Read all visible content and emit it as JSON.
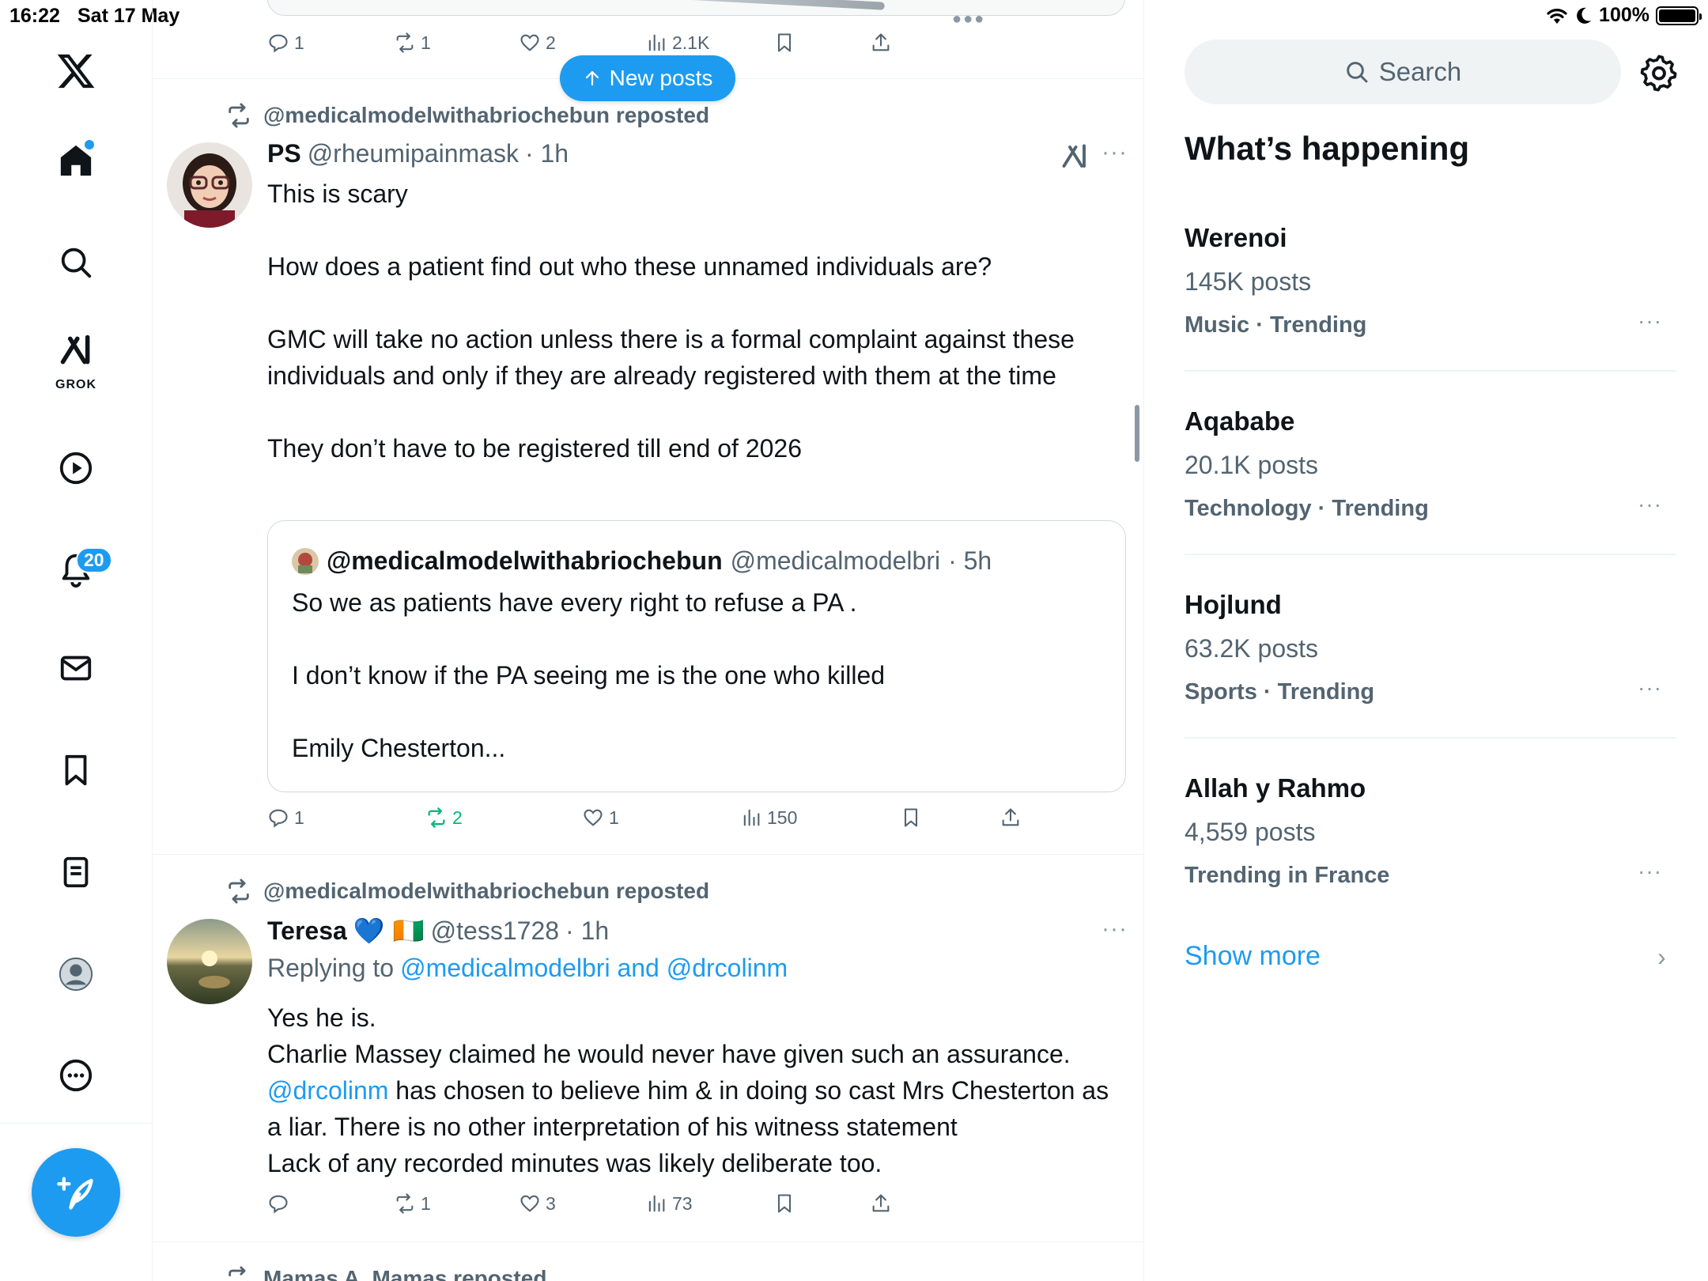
{
  "status_bar": {
    "time": "16:22",
    "date": "Sat 17 May",
    "battery": "100%"
  },
  "nav": {
    "grok_label": "GROK",
    "notifications_badge": "20"
  },
  "top_post_actions": {
    "replies": "1",
    "reposts": "1",
    "likes": "2",
    "views": "2.1K"
  },
  "new_posts_label": "New posts",
  "posts": [
    {
      "repost_by": "@medicalmodelwithabriochebun reposted",
      "name": "PS",
      "handle": "@rheumipainmask",
      "time": "· 1h",
      "text": [
        "This is scary",
        "",
        "How does a patient find out who these unnamed individuals are?",
        "",
        "GMC will take no action unless there is a formal complaint against these individuals and only if they are already registered with them at the time",
        "",
        "They don’t have to be registered till end of 2026"
      ],
      "quote": {
        "name": "@medicalmodelwithabriochebun",
        "handle": "@medicalmodelbri",
        "time": "· 5h",
        "text": [
          "So we as patients have every right to refuse a PA .",
          "",
          "I don’t know if the PA seeing me is the one who killed",
          "",
          "Emily Chesterton..."
        ]
      },
      "actions": {
        "replies": "1",
        "reposts": "2",
        "likes": "1",
        "views": "150"
      }
    },
    {
      "repost_by": "@medicalmodelwithabriochebun reposted",
      "name": "Teresa",
      "emoji": "💙 🇨🇮",
      "handle": "@tess1728",
      "time": "· 1h",
      "replying_prefix": "Replying to",
      "replying_to": "@medicalmodelbri and @drcolinm",
      "text_line1": "Yes he is.",
      "text_line2": "Charlie Massey claimed he would never have given such an assurance.",
      "text_mention": "@drcolinm",
      "text_line3_rest": " has chosen to believe him & in doing so cast Mrs Chesterton as a liar. There is no other interpretation of his witness statement",
      "text_line4": "Lack of any recorded minutes was likely deliberate too.",
      "actions": {
        "replies": "",
        "reposts": "1",
        "likes": "3",
        "views": "73"
      }
    }
  ],
  "next_repost": "Mamas A. Mamas reposted",
  "right": {
    "search_placeholder": "Search",
    "heading": "What’s happening",
    "trends": [
      {
        "name": "Werenoi",
        "count": "145K posts",
        "meta": "Music · Trending"
      },
      {
        "name": "Aqababe",
        "count": "20.1K posts",
        "meta": "Technology · Trending"
      },
      {
        "name": "Hojlund",
        "count": "63.2K posts",
        "meta": "Sports · Trending"
      },
      {
        "name": "Allah y Rahmo",
        "count": "4,559 posts",
        "meta": "Trending in France"
      }
    ],
    "show_more": "Show more"
  },
  "colors": {
    "accent": "#1d9bf0",
    "repost_green": "#00ba7c",
    "secondary_text": "#536471"
  }
}
